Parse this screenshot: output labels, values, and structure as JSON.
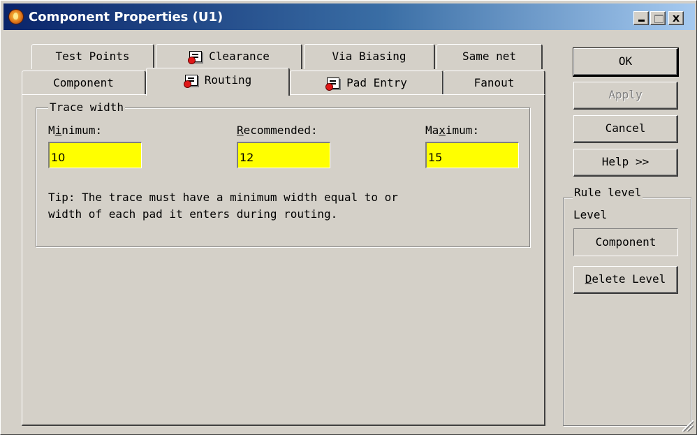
{
  "window": {
    "title": "Component Properties (U1)",
    "icon": "app-flame-icon",
    "caption_close": "x"
  },
  "tabs": {
    "row1": [
      {
        "label": "Test Points",
        "icon": null
      },
      {
        "label": "Clearance",
        "icon": "rule-sheet-icon"
      },
      {
        "label": "Via Biasing",
        "icon": null
      },
      {
        "label": "Same net",
        "icon": null
      }
    ],
    "row2": [
      {
        "label": "Component",
        "icon": null
      },
      {
        "label": "Routing",
        "icon": "rule-sheet-icon",
        "active": true
      },
      {
        "label": "Pad Entry",
        "icon": "rule-sheet-icon"
      },
      {
        "label": "Fanout",
        "icon": null
      }
    ]
  },
  "trace_width": {
    "legend": "Trace width",
    "minimum": {
      "label": "Minimum:",
      "accel": "i",
      "value": "10"
    },
    "recommended": {
      "label": "Recommended:",
      "accel": "R",
      "value": "12"
    },
    "maximum": {
      "label": "Maximum:",
      "accel": "x",
      "value": "15"
    },
    "tip": "Tip: The trace must have a minimum width equal to or\nwidth of each pad it enters during routing."
  },
  "buttons": {
    "ok": "OK",
    "apply": "Apply",
    "cancel": "Cancel",
    "help": "Help >>",
    "delete_level": "Delete Level"
  },
  "rule_level": {
    "legend": "Rule level",
    "level_label": "Level",
    "level_value": "Component"
  },
  "colors": {
    "field_background": "#ffff00",
    "face": "#d4d0c8",
    "title_gradient_start": "#0a246a",
    "title_gradient_end": "#a6caf0"
  }
}
